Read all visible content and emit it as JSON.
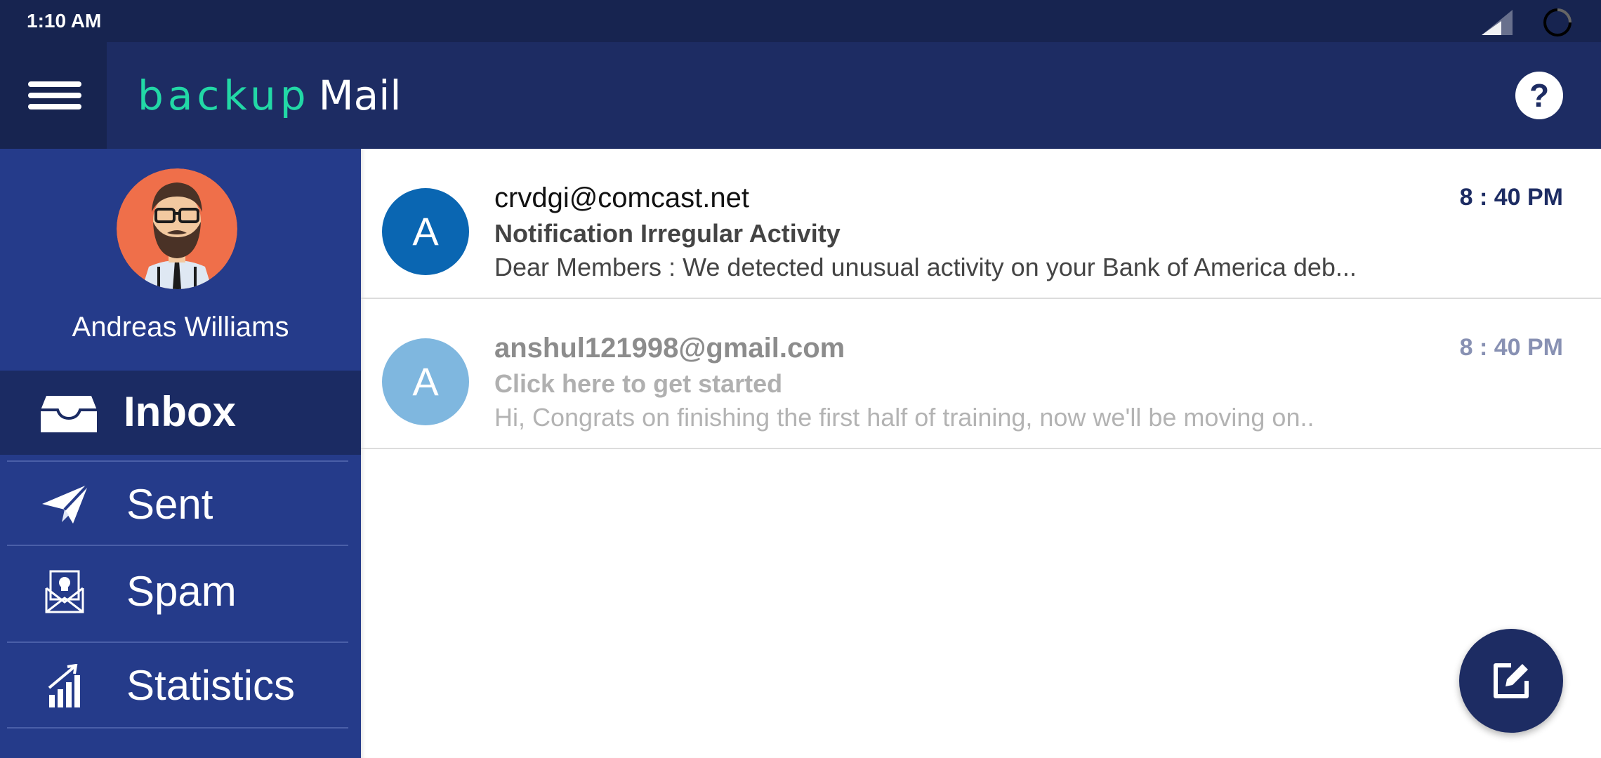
{
  "status_bar": {
    "time": "1:10 AM"
  },
  "app_bar": {
    "logo_backup": "backup",
    "logo_mail": "Mail",
    "help_label": "?"
  },
  "user": {
    "name": "Andreas Williams"
  },
  "nav": {
    "inbox": "Inbox",
    "sent": "Sent",
    "spam": "Spam",
    "statistics": "Statistics"
  },
  "emails": [
    {
      "avatar_letter": "A",
      "from": "crvdgi@comcast.net",
      "subject": "Notification Irregular Activity",
      "preview": "Dear Members : We detected unusual activity on your Bank of America deb...",
      "time": "8 : 40 PM",
      "read": false
    },
    {
      "avatar_letter": "A",
      "from": "anshul121998@gmail.com",
      "subject": "Click here to get started",
      "preview": "Hi, Congrats on finishing the first half of training, now we'll be moving on..",
      "time": "8 : 40 PM",
      "read": true
    }
  ],
  "colors": {
    "status_bar": "#172450",
    "app_bar": "#1d2c63",
    "sidebar": "#253b8a",
    "sidebar_active": "#1b2b63",
    "logo_accent": "#22d8a6",
    "unread_avatar": "#0a66b2",
    "read_avatar": "#7fb7df"
  },
  "icons": {
    "menu": "hamburger-menu-icon",
    "help": "help-icon",
    "inbox": "inbox-tray-icon",
    "sent": "paper-plane-icon",
    "spam": "spam-envelope-icon",
    "statistics": "bar-chart-icon",
    "compose": "compose-edit-icon"
  }
}
